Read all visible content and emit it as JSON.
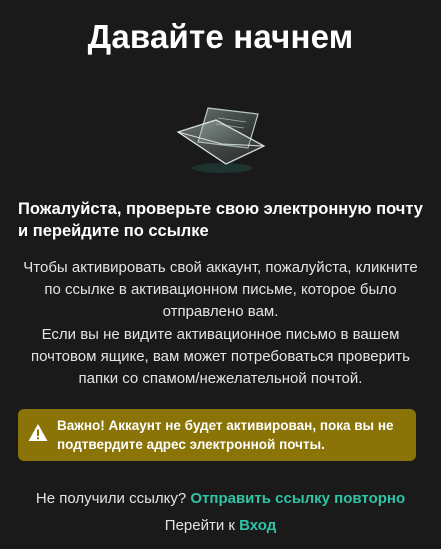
{
  "title": "Давайте начнем",
  "illustration": {
    "icon": "envelope-icon"
  },
  "subheading": "Пожалуйста, проверьте свою электронную почту и перейдите по ссылке",
  "paragraph1": "Чтобы активировать свой аккаунт, пожалуйста, кликните по ссылке в активационном письме, которое было отправлено вам.",
  "paragraph2": "Если вы не видите активационное письмо в вашем почтовом ящике, вам может потребоваться проверить папки со спамом/нежелательной почтой.",
  "alert": {
    "icon": "warning-icon",
    "text": "Важно! Аккаунт не будет активирован, пока вы не подтвердите адрес электронной почты.",
    "color": "#8a7407"
  },
  "resend": {
    "prompt": "Не получили ссылку?",
    "link_label": "Отправить ссылку повторно"
  },
  "login": {
    "prompt": "Перейти к",
    "link_label": "Вход"
  },
  "colors": {
    "background": "#1a1a1a",
    "link": "#2ec4a6",
    "alert": "#8a7407"
  }
}
